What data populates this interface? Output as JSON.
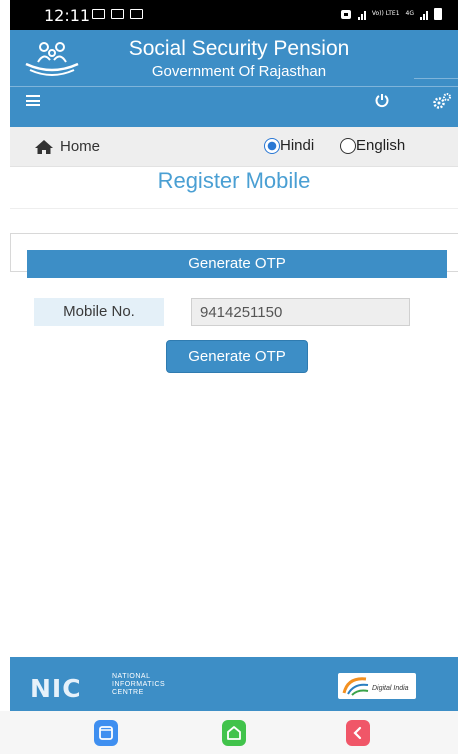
{
  "status_bar": {
    "time": "12:11",
    "network_labels": [
      "Vo)) LTE1",
      "4G"
    ]
  },
  "header": {
    "title": "Social Security Pension",
    "subtitle": "Government Of Rajasthan"
  },
  "nav": {
    "home_label": "Home",
    "languages": [
      {
        "label": "Hindi",
        "selected": true
      },
      {
        "label": "English",
        "selected": false
      }
    ]
  },
  "page": {
    "title": "Register Mobile",
    "panel_heading": "Generate OTP",
    "form": {
      "mobile_label": "Mobile No.",
      "mobile_value": "9414251150"
    },
    "submit_label": "Generate OTP"
  },
  "footer": {
    "nic_logo_text": "NIC",
    "nic_full_name": [
      "NATIONAL",
      "INFORMATICS",
      "CENTRE"
    ],
    "partner_logo_text": "Digital India"
  },
  "colors": {
    "primary": "#3d8ec6",
    "title_text": "#4a9fd3",
    "label_bg": "#e4f0f8",
    "radio_accent": "#2a78d4"
  }
}
